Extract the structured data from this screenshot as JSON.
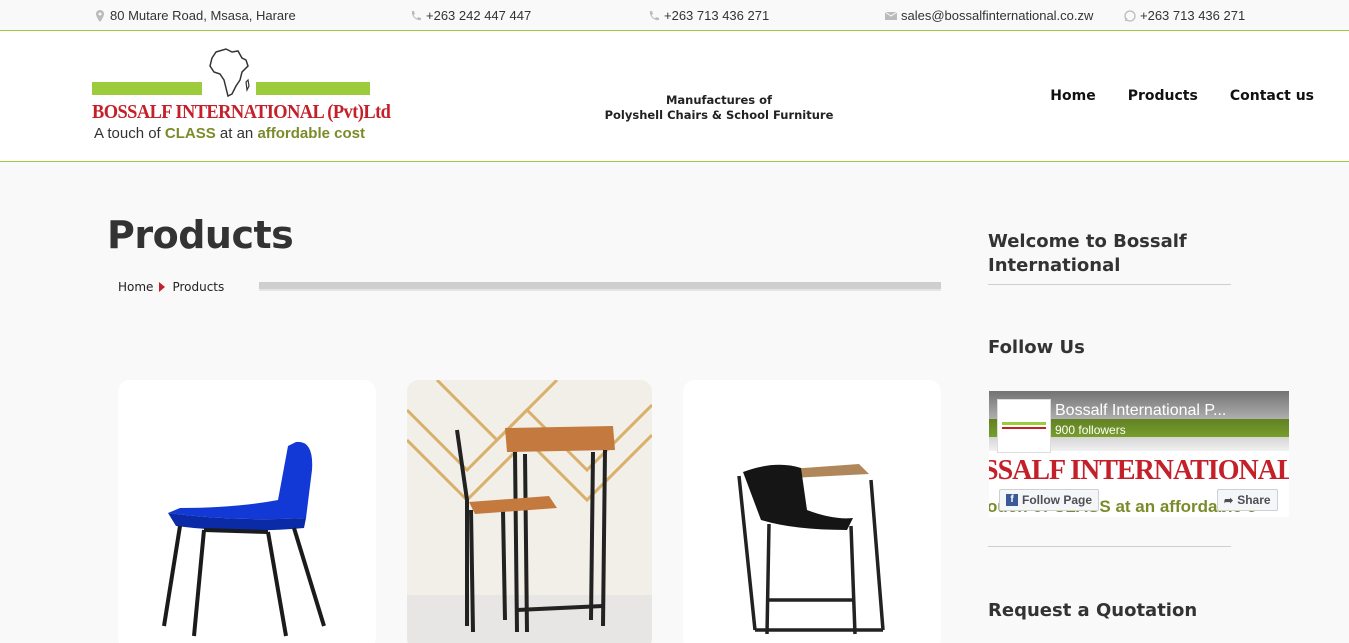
{
  "topbar": {
    "address": "80 Mutare Road, Msasa, Harare",
    "phone1": "+263 242 447 447",
    "phone2": "+263 713 436 271",
    "email": "sales@bossalfinternational.co.zw",
    "whatsapp": "+263 713 436 271"
  },
  "logo": {
    "brand": "BOSSALF INTERNATIONAL (Pvt)Ltd",
    "tag_a": "A touch of ",
    "tag_b": "CLASS",
    "tag_c": " at an ",
    "tag_d": "affordable cost"
  },
  "header": {
    "tagline_1": "Manufactures of",
    "tagline_2": "Polyshell Chairs & School Furniture"
  },
  "nav": {
    "home": "Home",
    "products": "Products",
    "contact": "Contact us"
  },
  "main": {
    "title": "Products",
    "crumb_home": "Home",
    "crumb_current": "Products"
  },
  "sidebar": {
    "welcome": "Welcome to Bossalf International",
    "follow": "Follow Us",
    "quote": "Request a Quotation",
    "fb_name": "Bossalf International P...",
    "fb_followers": "900 followers",
    "fb_follow": "Follow Page",
    "fb_share": "Share",
    "fb_brand": "SSALF INTERNATIONAL (Pvt)L",
    "fb_tag": "ouch of CLASS at an affordable c"
  },
  "colors": {
    "accent_green": "#9ccc3c",
    "brand_red": "#c4202a"
  }
}
